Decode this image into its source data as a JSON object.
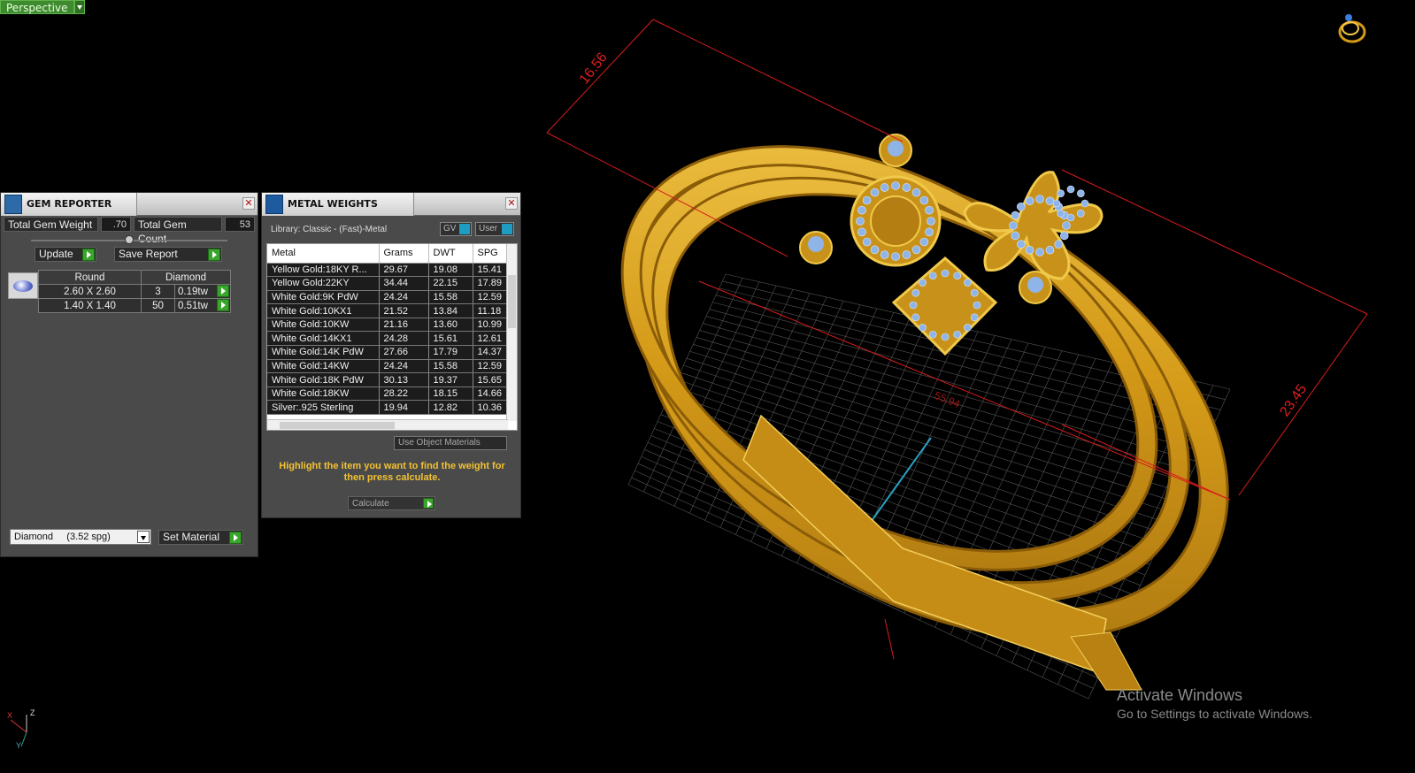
{
  "viewport": {
    "mode": "Perspective"
  },
  "gem_reporter": {
    "title": "GEM REPORTER",
    "total_gem_weight_label": "Total Gem Weight",
    "total_gem_weight": ".70",
    "total_gem_count_label": "Total Gem Count",
    "total_gem_count": "53",
    "update_label": "Update",
    "save_report_label": "Save Report",
    "table_headers": [
      "Round",
      "Diamond"
    ],
    "rows": [
      {
        "size": "2.60 X 2.60",
        "count": "3",
        "weight": "0.19tw"
      },
      {
        "size": "1.40 X 1.40",
        "count": "50",
        "weight": "0.51tw"
      }
    ],
    "material_select": "Diamond     (3.52 spg)",
    "set_material_label": "Set Material"
  },
  "metal_weights": {
    "title": "METAL WEIGHTS",
    "library": "Library: Classic - (Fast)-Metal",
    "toggle_gv": "GV",
    "toggle_user": "User",
    "headers": [
      "Metal",
      "Grams",
      "DWT",
      "SPG"
    ],
    "rows": [
      [
        "Yellow Gold:18KY R...",
        "29.67",
        "19.08",
        "15.41"
      ],
      [
        "Yellow Gold:22KY",
        "34.44",
        "22.15",
        "17.89"
      ],
      [
        "White Gold:9K PdW",
        "24.24",
        "15.58",
        "12.59"
      ],
      [
        "White Gold:10KX1",
        "21.52",
        "13.84",
        "11.18"
      ],
      [
        "White Gold:10KW",
        "21.16",
        "13.60",
        "10.99"
      ],
      [
        "White Gold:14KX1",
        "24.28",
        "15.61",
        "12.61"
      ],
      [
        "White Gold:14K PdW",
        "27.66",
        "17.79",
        "14.37"
      ],
      [
        "White Gold:14KW",
        "24.24",
        "15.58",
        "12.59"
      ],
      [
        "White Gold:18K PdW",
        "30.13",
        "19.37",
        "15.65"
      ],
      [
        "White Gold:18KW",
        "28.22",
        "18.15",
        "14.66"
      ],
      [
        "Silver:.925 Sterling",
        "19.94",
        "12.82",
        "10.36"
      ]
    ],
    "use_object_materials": "Use Object Materials",
    "instruction": "Highlight the item you want to find the weight for then press calculate.",
    "calculate_label": "Calculate"
  },
  "dimensions": {
    "d1": "16.56",
    "d2": "23.45",
    "d3": "55.94"
  },
  "axis_labels": {
    "z": "Z",
    "x": "X",
    "y": "Y"
  },
  "watermark": {
    "line1": "Activate Windows",
    "line2": "Go to Settings to activate Windows."
  },
  "colors": {
    "metal_gold": "#d8a31c",
    "gem_blue": "#8fb4e8",
    "dimension_red": "#d81c1c",
    "instruction_yellow": "#f2c232",
    "go_green": "#3aa52c"
  }
}
